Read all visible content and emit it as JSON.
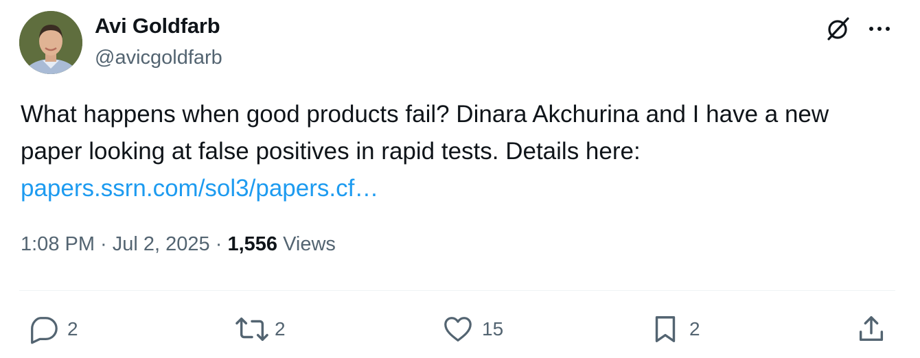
{
  "author": {
    "name": "Avi Goldfarb",
    "handle": "@avicgoldfarb",
    "avatar_icon": "profile-photo"
  },
  "tweet": {
    "text": "What happens when good products fail? Dinara Akchurina and I have a new paper looking at false positives in rapid tests. Details here:",
    "link_text": "papers.ssrn.com/sol3/papers.cf…"
  },
  "meta": {
    "time": "1:08 PM",
    "separator": " · ",
    "date": "Jul 2, 2025",
    "views_count": "1,556",
    "views_label": "Views"
  },
  "actions": {
    "replies": "2",
    "reposts": "2",
    "likes": "15",
    "bookmarks": "2"
  },
  "icons": {
    "grok": "grok-icon",
    "more": "more-icon",
    "reply": "reply-icon",
    "repost": "repost-icon",
    "like": "like-icon",
    "bookmark": "bookmark-icon",
    "share": "share-icon"
  },
  "colors": {
    "text": "#0f1419",
    "secondary": "#536471",
    "link": "#1d9bf0",
    "divider": "#eff3f4"
  }
}
